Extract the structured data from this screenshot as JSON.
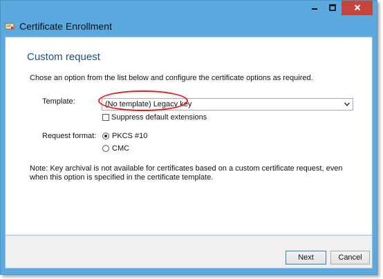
{
  "window": {
    "title": "Certificate Enrollment",
    "controls": {
      "minimize_icon": "minimize-icon",
      "maximize_icon": "maximize-icon",
      "close_icon": "close-icon"
    },
    "colors": {
      "frame": "#5ba9df",
      "close": "#c7443b",
      "heading": "#1c4e8a",
      "highlight": "#e51a22"
    }
  },
  "page": {
    "heading": "Custom request",
    "description": "Chose an option from the list below and configure the certificate options as required.",
    "template": {
      "label": "Template:",
      "selected": "(No template) Legacy key"
    },
    "suppress_extensions": {
      "label": "Suppress default extensions",
      "checked": false
    },
    "request_format": {
      "label": "Request format:",
      "options": [
        {
          "label": "PKCS #10",
          "selected": true
        },
        {
          "label": "CMC",
          "selected": false
        }
      ]
    },
    "note": "Note: Key archival is not available for certificates based on a custom certificate request, even when this option is specified in the certificate template."
  },
  "footer": {
    "next_label": "Next",
    "cancel_label": "Cancel"
  }
}
